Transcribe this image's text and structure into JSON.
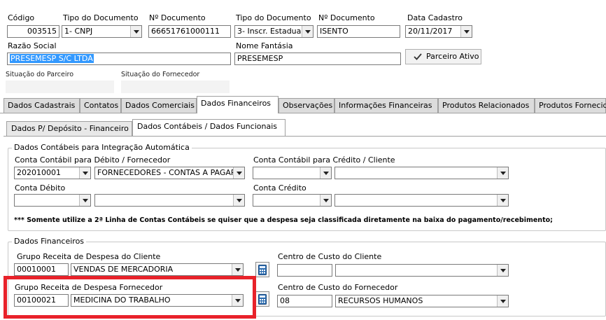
{
  "header": {
    "codigo_label": "Código",
    "codigo_value": "003515",
    "tipo_doc_label": "Tipo do Documento",
    "tipo_doc_value": "1- CNPJ",
    "num_doc_label": "Nº Documento",
    "num_doc_value": "66651761000111",
    "tipo_doc2_label": "Tipo do Documento",
    "tipo_doc2_value": "3- Inscr. Estadual",
    "num_doc2_label": "Nº Documento",
    "num_doc2_value": "ISENTO",
    "data_cadastro_label": "Data Cadastro",
    "data_cadastro_value": "20/11/2017",
    "razao_social_label": "Razão Social",
    "razao_social_value": "PRESEMESP S/C LTDA",
    "nome_fantasia_label": "Nome Fantásia",
    "nome_fantasia_value": "PRESEMESP",
    "parceiro_ativo_label": "Parceiro Ativo",
    "situacao_parceiro_label": "Situação do Parceiro",
    "situacao_fornecedor_label": "Situação do Fornecedor"
  },
  "tabs": [
    {
      "label": "Dados Cadastrais"
    },
    {
      "label": "Contatos"
    },
    {
      "label": "Dados Comerciais"
    },
    {
      "label": "Dados Financeiros"
    },
    {
      "label": "Observações"
    },
    {
      "label": "Informações Financeiras"
    },
    {
      "label": "Produtos Relacionados"
    },
    {
      "label": "Produtos Fornecidos"
    }
  ],
  "subtabs": [
    {
      "label": "Dados P/ Depósito - Financeiro"
    },
    {
      "label": "Dados Contábeis /  Dados Funcionais"
    }
  ],
  "contabeis": {
    "group_title": "Dados Contábeis para Integração Automática",
    "debito_fornecedor_label": "Conta Contábil para Débito / Fornecedor",
    "debito_fornecedor_code": "202010001",
    "debito_fornecedor_desc": "FORNECEDORES - CONTAS A PAGAR",
    "credito_cliente_label": "Conta Contábil para Crédito / Cliente",
    "conta_debito_label": "Conta Débito",
    "conta_credito_label": "Conta Crédito",
    "note": "*** Somente utilize a 2ª Linha de Contas Contábeis se quiser que a despesa seja classificada diretamente na baixa do pagamento/recebimento;"
  },
  "financeiros": {
    "group_title": "Dados Financeiros",
    "grupo_cliente_label": "Grupo Receita de Despesa do Cliente",
    "grupo_cliente_code": "00010001",
    "grupo_cliente_desc": "VENDAS DE MERCADORIA",
    "centro_cliente_label": "Centro de Custo do Cliente",
    "grupo_fornecedor_label": "Grupo Receita de Despesa Fornecedor",
    "grupo_fornecedor_code": "00100021",
    "grupo_fornecedor_desc": "MEDICINA DO TRABALHO",
    "centro_fornecedor_label": "Centro de Custo do Fornecedor",
    "centro_fornecedor_code": "08",
    "centro_fornecedor_desc": "RECURSOS HUMANOS"
  },
  "colors": {
    "highlight": "#e8222a",
    "selection": "#3399ff"
  }
}
